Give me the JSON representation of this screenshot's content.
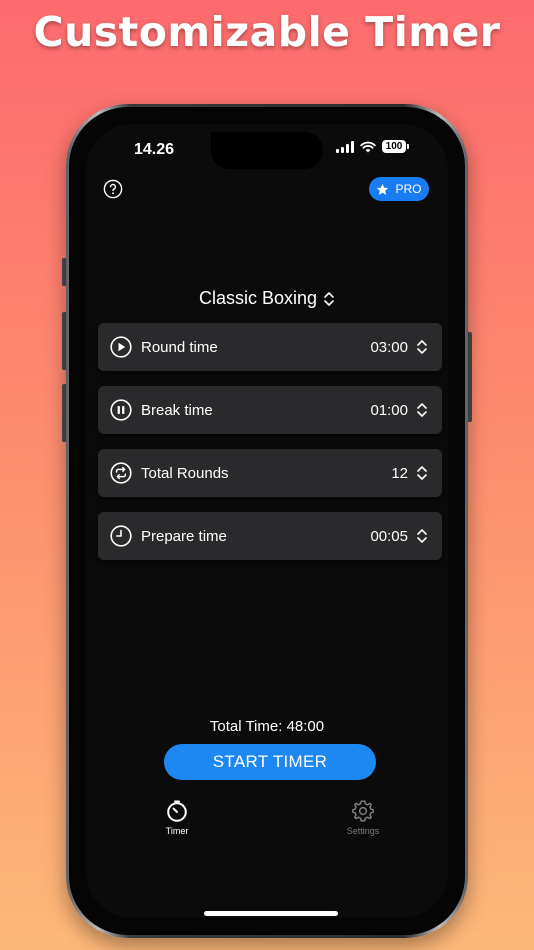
{
  "headline": "Customizable Timer",
  "status_bar": {
    "time": "14.26",
    "battery": "100"
  },
  "header": {
    "help_icon": "question-circle-icon",
    "pro_label": "PRO"
  },
  "preset": {
    "name": "Classic Boxing"
  },
  "settings": [
    {
      "label": "Round time",
      "value": "03:00",
      "icon": "play-circle-icon"
    },
    {
      "label": "Break time",
      "value": "01:00",
      "icon": "pause-circle-icon"
    },
    {
      "label": "Total Rounds",
      "value": "12",
      "icon": "repeat-circle-icon"
    },
    {
      "label": "Prepare time",
      "value": "00:05",
      "icon": "clock-icon"
    }
  ],
  "total_time": "Total Time: 48:00",
  "start_button": "START TIMER",
  "tabs": [
    {
      "label": "Timer",
      "icon": "timer-icon",
      "active": true
    },
    {
      "label": "Settings",
      "icon": "gear-icon",
      "active": false
    }
  ],
  "colors": {
    "accent": "#1e88f2",
    "background": "#0b0b0c",
    "card": "#2a2a2d"
  }
}
